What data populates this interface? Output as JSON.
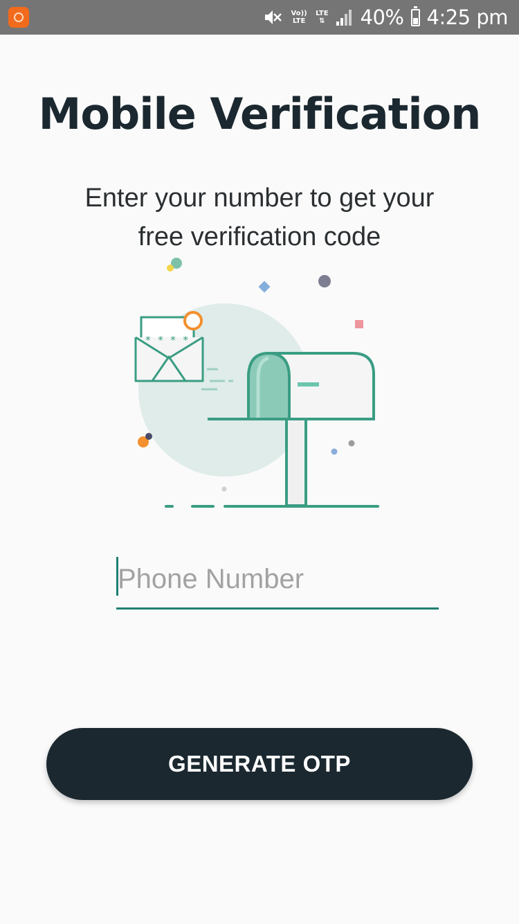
{
  "status_bar": {
    "volte_label": "Vo)) LTE",
    "lte_label": "LTE",
    "battery_percent": "40%",
    "battery_level": 0.4,
    "time": "4:25 pm",
    "icons": [
      "app-notification-icon",
      "mute-icon",
      "volte-icon",
      "lte-data-icon",
      "signal-icon",
      "battery-icon"
    ]
  },
  "page": {
    "title": "Mobile Verification",
    "subtitle": "Enter your number to get your free verification code"
  },
  "illustration": {
    "description_icon": "mailbox-envelope-illustration",
    "envelope_code": "* * * *"
  },
  "form": {
    "phone_value": "",
    "phone_placeholder": "Phone Number"
  },
  "actions": {
    "generate_label": "GENERATE OTP"
  },
  "colors": {
    "background": "#fafafa",
    "status_bar": "#757575",
    "title": "#1b2830",
    "accent": "#1f7f72",
    "illustration_teal": "#3a9d83",
    "button": "#1b2830",
    "button_text": "#ffffff"
  }
}
